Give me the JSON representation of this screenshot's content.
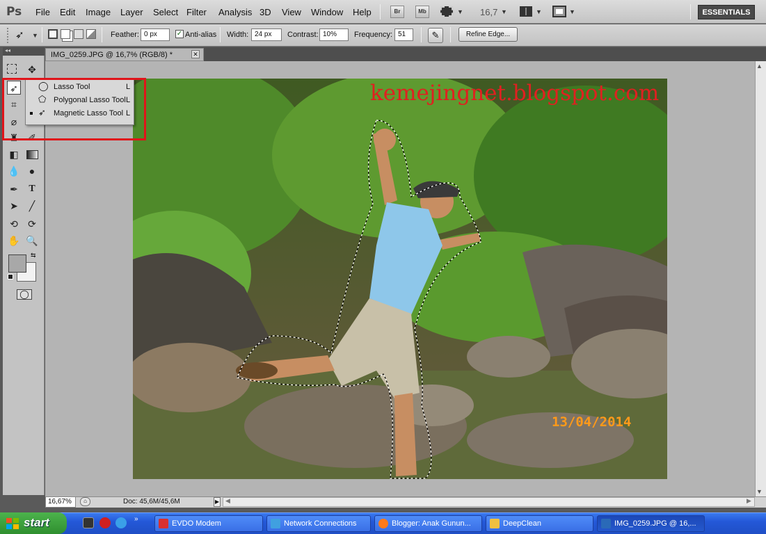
{
  "menubar": {
    "logo": "Ps",
    "menus": [
      "File",
      "Edit",
      "Image",
      "Layer",
      "Select",
      "Filter",
      "Analysis",
      "3D",
      "View",
      "Window",
      "Help"
    ],
    "bridge_label": "Br",
    "minibridge_label": "Mb",
    "zoom": "16,7",
    "workspace": "ESSENTIALS"
  },
  "options": {
    "feather_label": "Feather:",
    "feather_value": "0 px",
    "antialias_label": "Anti-alias",
    "antialias_checked": true,
    "width_label": "Width:",
    "width_value": "24 px",
    "contrast_label": "Contrast:",
    "contrast_value": "10%",
    "frequency_label": "Frequency:",
    "frequency_value": "51",
    "refine_edge": "Refine Edge..."
  },
  "document": {
    "tab_title": "IMG_0259.JPG @ 16,7% (RGB/8) *",
    "watermark": "kemejingnet.blogspot.com",
    "datestamp": "13/04/2014"
  },
  "flyout": {
    "items": [
      {
        "label": "Lasso Tool",
        "shortcut": "L",
        "icon": "lasso-icon",
        "selected": false
      },
      {
        "label": "Polygonal Lasso Tool",
        "shortcut": "L",
        "icon": "polygonal-lasso-icon",
        "selected": false
      },
      {
        "label": "Magnetic Lasso Tool",
        "shortcut": "L",
        "icon": "magnetic-lasso-icon",
        "selected": true
      }
    ]
  },
  "status": {
    "zoom": "16,67%",
    "doc_info": "Doc: 45,6M/45,6M"
  },
  "taskbar": {
    "start": "start",
    "tasks": [
      {
        "label": "EVDO Modem",
        "color": "#d83030"
      },
      {
        "label": "Network Connections",
        "color": "#40a0e0"
      },
      {
        "label": "Blogger: Anak Gunun...",
        "color": "#ff7a1a"
      },
      {
        "label": "DeepClean",
        "color": "#f0c040"
      },
      {
        "label": "IMG_0259.JPG @ 16,...",
        "color": "#2a6ab8"
      }
    ]
  },
  "colors": {
    "selection_frame": "#e0141a",
    "watermark": "#e02020",
    "datestamp": "#ff9a1a"
  }
}
